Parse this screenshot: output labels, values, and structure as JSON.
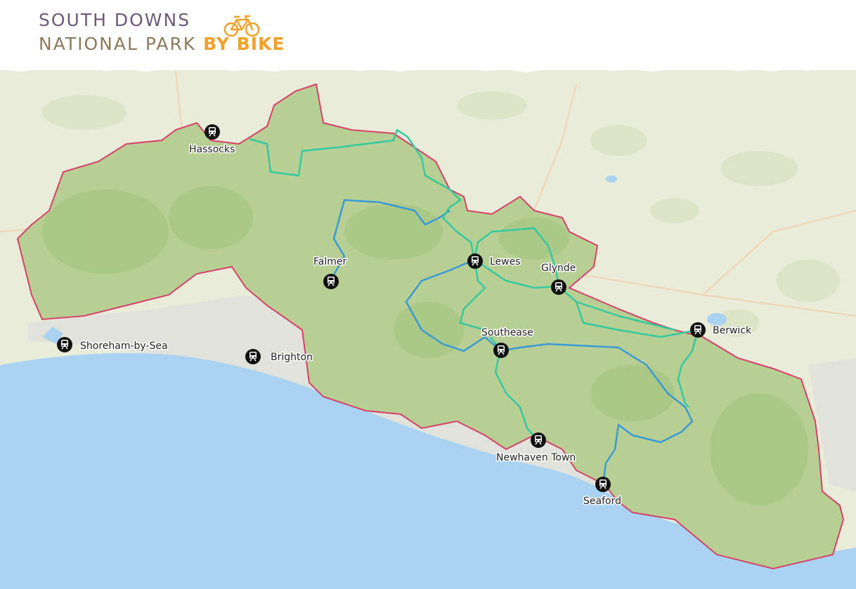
{
  "header": {
    "logo_line1": "SOUTH DOWNS",
    "logo_line2": "NATIONAL PARK",
    "logo_suffix": "BY BIKE",
    "logo_icon": "bicycle-icon"
  },
  "map": {
    "colors": {
      "sea": "#a9d3f1",
      "land": "#e9ecd9",
      "park": "#b7cf92",
      "boundary": "#d6416b",
      "route_blue": "#3a9ad6",
      "route_green": "#34c9a0",
      "urban": "#e2e2dc"
    },
    "station_icon": "train-station-icon",
    "stations": [
      {
        "name": "Hassocks"
      },
      {
        "name": "Falmer"
      },
      {
        "name": "Lewes"
      },
      {
        "name": "Glynde"
      },
      {
        "name": "Berwick"
      },
      {
        "name": "Southease"
      },
      {
        "name": "Shoreham-by-Sea"
      },
      {
        "name": "Brighton"
      },
      {
        "name": "Newhaven Town"
      },
      {
        "name": "Seaford"
      }
    ]
  }
}
